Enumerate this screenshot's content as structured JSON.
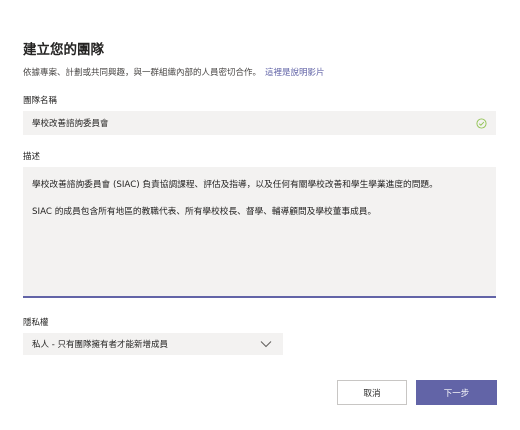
{
  "dialog": {
    "title": "建立您的團隊",
    "subtitle": "依據專案、計劃或共同興趣，與一群組織內部的人員密切合作。",
    "help_link": "這裡是說明影片"
  },
  "team_name": {
    "label": "團隊名稱",
    "value": "學校改善諮詢委員會",
    "status_icon": "check-circle-icon",
    "status_color": "#92c353"
  },
  "description": {
    "label": "描述",
    "paragraphs": [
      "學校改善諮詢委員會 (SIAC) 負責協調課程、評估及指導，以及任何有關學校改善和學生學業進度的問題。",
      "SIAC 的成員包含所有地區的教職代表、所有學校校長、督學、輔導顧問及學校董事成員。"
    ],
    "focus_underline_color": "#6264a7"
  },
  "privacy": {
    "label": "隱私權",
    "selected": "私人 - 只有團隊擁有者才能新增成員",
    "icon": "chevron-down-icon"
  },
  "actions": {
    "cancel_label": "取消",
    "next_label": "下一步",
    "primary_color": "#6264a7"
  }
}
